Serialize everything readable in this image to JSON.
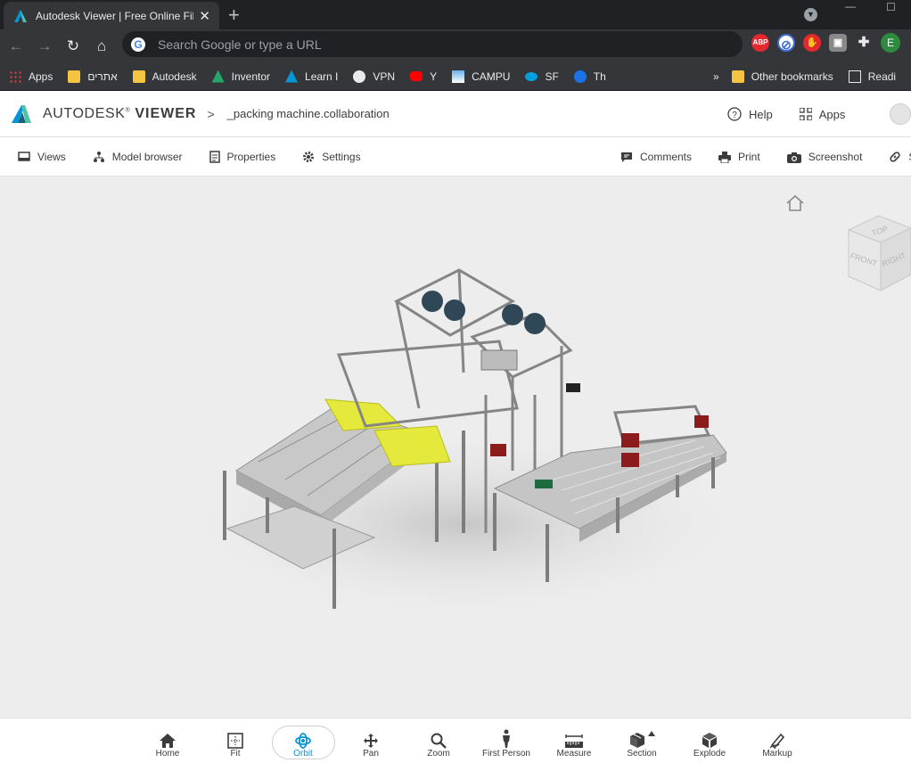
{
  "browser": {
    "tab_title": "Autodesk Viewer | Free Online Fil",
    "close": "✕",
    "new_tab": "+",
    "omnibox_placeholder": "Search Google or type a URL",
    "dropdown": "▼",
    "profile_initial": "E",
    "extensions": [
      {
        "name": "adblock-plus",
        "label": "ABP",
        "color": "#e5282e"
      },
      {
        "name": "block-icon",
        "label": "⊘",
        "color": "#3c6ed3"
      },
      {
        "name": "stop-hand",
        "label": "✋",
        "color": "#e5282e"
      },
      {
        "name": "grey-ext",
        "label": "▣",
        "color": "#888"
      },
      {
        "name": "puzzle",
        "label": "✚",
        "color": "#35363a"
      }
    ],
    "bookmarks": [
      {
        "label": "Apps",
        "icon": "apps-grid-icon"
      },
      {
        "label": "אתרים",
        "icon": "folder-icon"
      },
      {
        "label": "Autodesk",
        "icon": "folder-icon"
      },
      {
        "label": "Inventor",
        "icon": "inventor-icon"
      },
      {
        "label": "Learn I",
        "icon": "autodesk-icon"
      },
      {
        "label": "VPN",
        "icon": "globe-icon"
      },
      {
        "label": "Y",
        "icon": "youtube-icon"
      },
      {
        "label": "CAMPU",
        "icon": "campus-icon"
      },
      {
        "label": "SF",
        "icon": "salesforce-icon"
      },
      {
        "label": "Th",
        "icon": "th-icon"
      }
    ],
    "bookmarks_more": "»",
    "other_bookmarks": "Other bookmarks",
    "reading": "Readi"
  },
  "app": {
    "brand_prefix": "AUTODESK",
    "brand_suffix": "VIEWER",
    "breadcrumb_sep": ">",
    "file_name": "_packing machine.collaboration",
    "help": "Help",
    "apps": "Apps"
  },
  "sub_toolbar": {
    "left": [
      {
        "label": "Views",
        "icon": "views-icon"
      },
      {
        "label": "Model browser",
        "icon": "model-browser-icon"
      },
      {
        "label": "Properties",
        "icon": "properties-icon"
      },
      {
        "label": "Settings",
        "icon": "settings-icon"
      }
    ],
    "right": [
      {
        "label": "Comments",
        "icon": "comments-icon"
      },
      {
        "label": "Print",
        "icon": "print-icon"
      },
      {
        "label": "Screenshot",
        "icon": "camera-icon"
      },
      {
        "label": "Sl",
        "icon": "link-icon"
      }
    ]
  },
  "viewcube": {
    "top": "TOP",
    "front": "FRONT",
    "right": "RIGHT"
  },
  "bottom_tools": [
    {
      "label": "Home",
      "icon": "home-icon",
      "active": false
    },
    {
      "label": "Fit",
      "icon": "fit-icon",
      "active": false
    },
    {
      "label": "Orbit",
      "icon": "orbit-icon",
      "active": true
    },
    {
      "label": "Pan",
      "icon": "pan-icon",
      "active": false
    },
    {
      "label": "Zoom",
      "icon": "zoom-icon",
      "active": false
    },
    {
      "label": "First Person",
      "icon": "first-person-icon",
      "active": false
    },
    {
      "label": "Measure",
      "icon": "measure-icon",
      "active": false
    },
    {
      "label": "Section",
      "icon": "section-icon",
      "active": false
    },
    {
      "label": "Explode",
      "icon": "explode-icon",
      "active": false
    },
    {
      "label": "Markup",
      "icon": "markup-icon",
      "active": false
    }
  ]
}
